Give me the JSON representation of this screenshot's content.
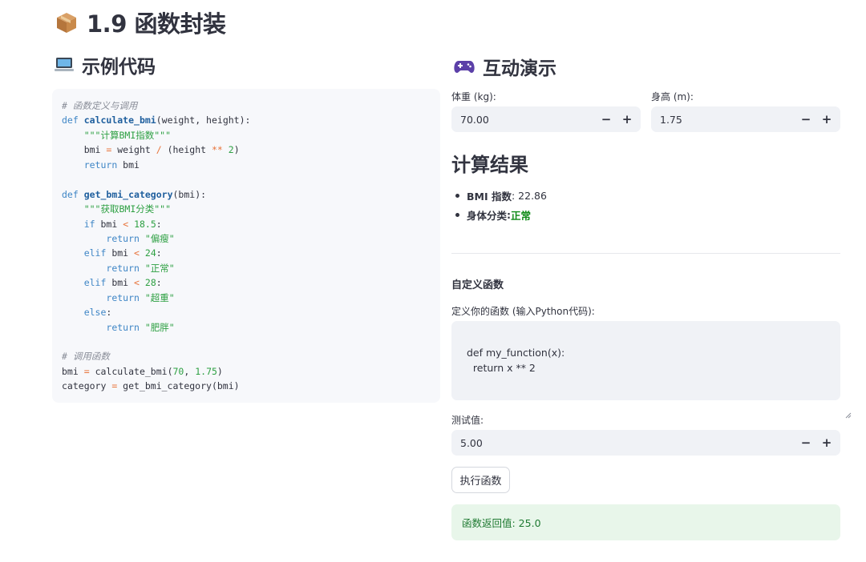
{
  "page": {
    "title": "1.9 函数封装"
  },
  "code_section": {
    "title": "示例代码",
    "lines": [
      [
        {
          "t": "# 函数定义与调用",
          "c": "com"
        }
      ],
      [
        {
          "t": "def",
          "c": "kw"
        },
        {
          "t": " "
        },
        {
          "t": "calculate_bmi",
          "c": "fn"
        },
        {
          "t": "(weight, height):"
        }
      ],
      [
        {
          "t": "    "
        },
        {
          "t": "\"\"\"计算BMI指数\"\"\"",
          "c": "str"
        }
      ],
      [
        {
          "t": "    bmi "
        },
        {
          "t": "=",
          "c": "op"
        },
        {
          "t": " weight "
        },
        {
          "t": "/",
          "c": "op"
        },
        {
          "t": " (height "
        },
        {
          "t": "**",
          "c": "op"
        },
        {
          "t": " "
        },
        {
          "t": "2",
          "c": "num"
        },
        {
          "t": ")"
        }
      ],
      [
        {
          "t": "    "
        },
        {
          "t": "return",
          "c": "kw"
        },
        {
          "t": " bmi"
        }
      ],
      [
        {
          "t": ""
        }
      ],
      [
        {
          "t": "def",
          "c": "kw"
        },
        {
          "t": " "
        },
        {
          "t": "get_bmi_category",
          "c": "fn"
        },
        {
          "t": "(bmi):"
        }
      ],
      [
        {
          "t": "    "
        },
        {
          "t": "\"\"\"获取BMI分类\"\"\"",
          "c": "str"
        }
      ],
      [
        {
          "t": "    "
        },
        {
          "t": "if",
          "c": "kw"
        },
        {
          "t": " bmi "
        },
        {
          "t": "<",
          "c": "op"
        },
        {
          "t": " "
        },
        {
          "t": "18.5",
          "c": "num"
        },
        {
          "t": ":"
        }
      ],
      [
        {
          "t": "        "
        },
        {
          "t": "return",
          "c": "kw"
        },
        {
          "t": " "
        },
        {
          "t": "\"偏瘦\"",
          "c": "str"
        }
      ],
      [
        {
          "t": "    "
        },
        {
          "t": "elif",
          "c": "kw"
        },
        {
          "t": " bmi "
        },
        {
          "t": "<",
          "c": "op"
        },
        {
          "t": " "
        },
        {
          "t": "24",
          "c": "num"
        },
        {
          "t": ":"
        }
      ],
      [
        {
          "t": "        "
        },
        {
          "t": "return",
          "c": "kw"
        },
        {
          "t": " "
        },
        {
          "t": "\"正常\"",
          "c": "str"
        }
      ],
      [
        {
          "t": "    "
        },
        {
          "t": "elif",
          "c": "kw"
        },
        {
          "t": " bmi "
        },
        {
          "t": "<",
          "c": "op"
        },
        {
          "t": " "
        },
        {
          "t": "28",
          "c": "num"
        },
        {
          "t": ":"
        }
      ],
      [
        {
          "t": "        "
        },
        {
          "t": "return",
          "c": "kw"
        },
        {
          "t": " "
        },
        {
          "t": "\"超重\"",
          "c": "str"
        }
      ],
      [
        {
          "t": "    "
        },
        {
          "t": "else",
          "c": "kw"
        },
        {
          "t": ":"
        }
      ],
      [
        {
          "t": "        "
        },
        {
          "t": "return",
          "c": "kw"
        },
        {
          "t": " "
        },
        {
          "t": "\"肥胖\"",
          "c": "str"
        }
      ],
      [
        {
          "t": ""
        }
      ],
      [
        {
          "t": "# 调用函数",
          "c": "com"
        }
      ],
      [
        {
          "t": "bmi "
        },
        {
          "t": "=",
          "c": "op"
        },
        {
          "t": " calculate_bmi("
        },
        {
          "t": "70",
          "c": "num"
        },
        {
          "t": ", "
        },
        {
          "t": "1.75",
          "c": "num"
        },
        {
          "t": ")"
        }
      ],
      [
        {
          "t": "category "
        },
        {
          "t": "=",
          "c": "op"
        },
        {
          "t": " get_bmi_category(bmi)"
        }
      ]
    ]
  },
  "demo": {
    "title": "互动演示",
    "weight": {
      "label": "体重 (kg):",
      "value": "70.00"
    },
    "height": {
      "label": "身高 (m):",
      "value": "1.75"
    },
    "stepper": {
      "minus": "−",
      "plus": "+"
    },
    "result_title": "计算结果",
    "bmi": {
      "label": "BMI 指数",
      "value": ": 22.86"
    },
    "category": {
      "label": "身体分类",
      "sep": ": ",
      "value": "正常"
    },
    "custom": {
      "title": "自定义函数",
      "code_label": "定义你的函数 (输入Python代码):",
      "code": "def my_function(x):\n    return x ** 2",
      "test_label": "测试值:",
      "test_value": "5.00",
      "run_button": "执行函数",
      "output": "函数返回值: 25.0"
    }
  },
  "colors": {
    "accent_green": "#0e8a16",
    "success_bg": "#e8f6ea",
    "input_bg": "#f0f2f6"
  }
}
